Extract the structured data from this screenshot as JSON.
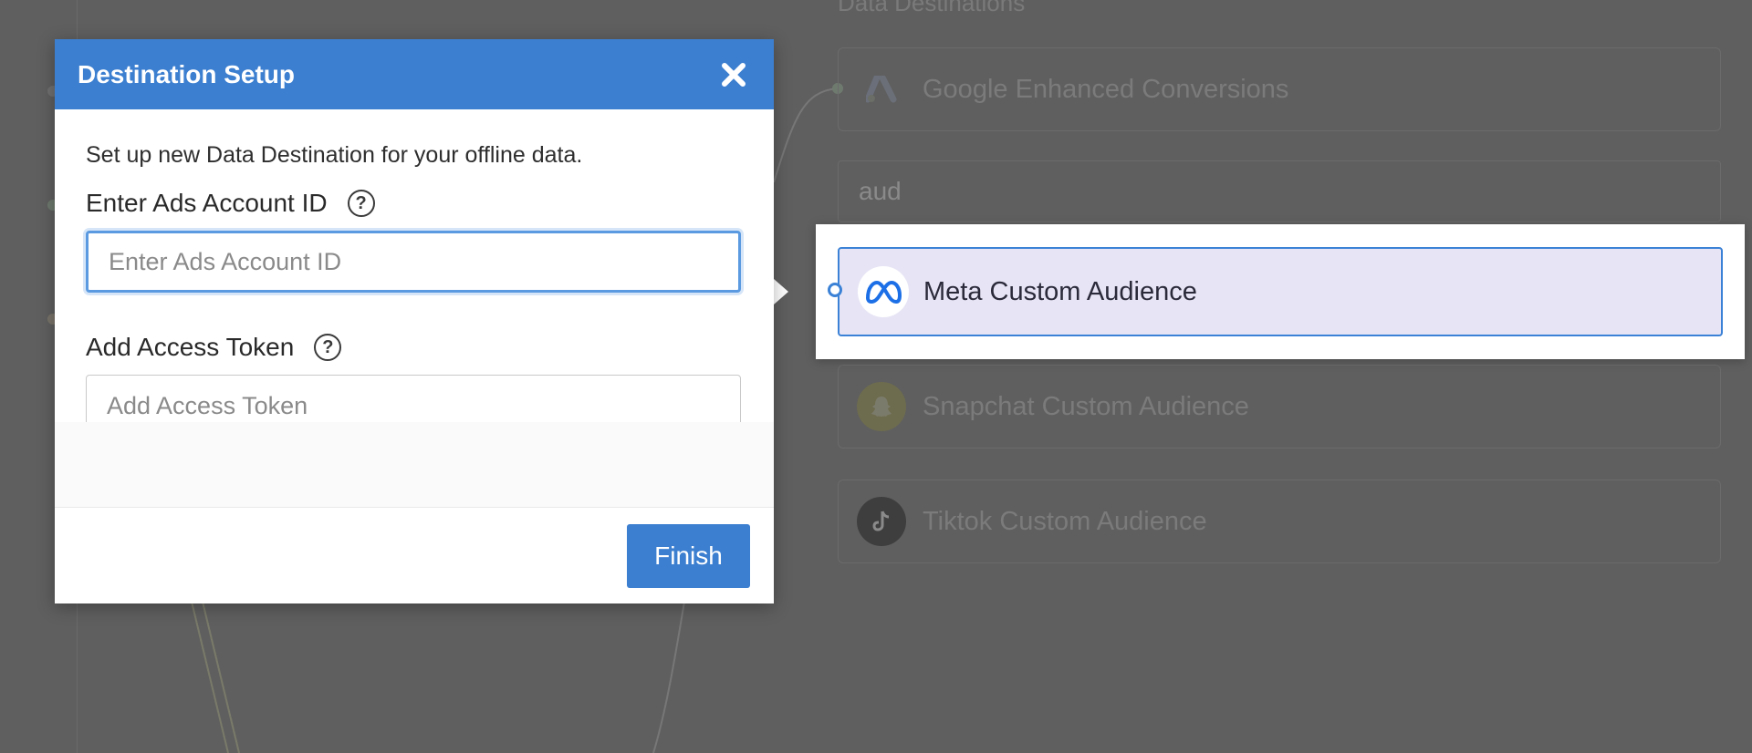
{
  "background": {
    "header": "Data Destinations",
    "search_value": "aud",
    "items": [
      {
        "label": "Google Enhanced Conversions",
        "icon": "google-ads-icon"
      },
      {
        "label": "Snapchat Custom Audience",
        "icon": "snapchat-icon"
      },
      {
        "label": "Tiktok Custom Audience",
        "icon": "tiktok-icon"
      }
    ],
    "selected_item": {
      "label": "Meta Custom Audience",
      "icon": "meta-icon"
    }
  },
  "modal": {
    "title": "Destination Setup",
    "description": "Set up new Data Destination for your offline data.",
    "fields": [
      {
        "label": "Enter Ads Account ID",
        "placeholder": "Enter Ads Account ID",
        "value": ""
      },
      {
        "label": "Add Access Token",
        "placeholder": "Add Access Token",
        "value": ""
      }
    ],
    "finish_label": "Finish"
  },
  "colors": {
    "accent": "#3c7fd0",
    "overlay": "#5f5f5f",
    "selected_bg": "#e7e5f5"
  }
}
